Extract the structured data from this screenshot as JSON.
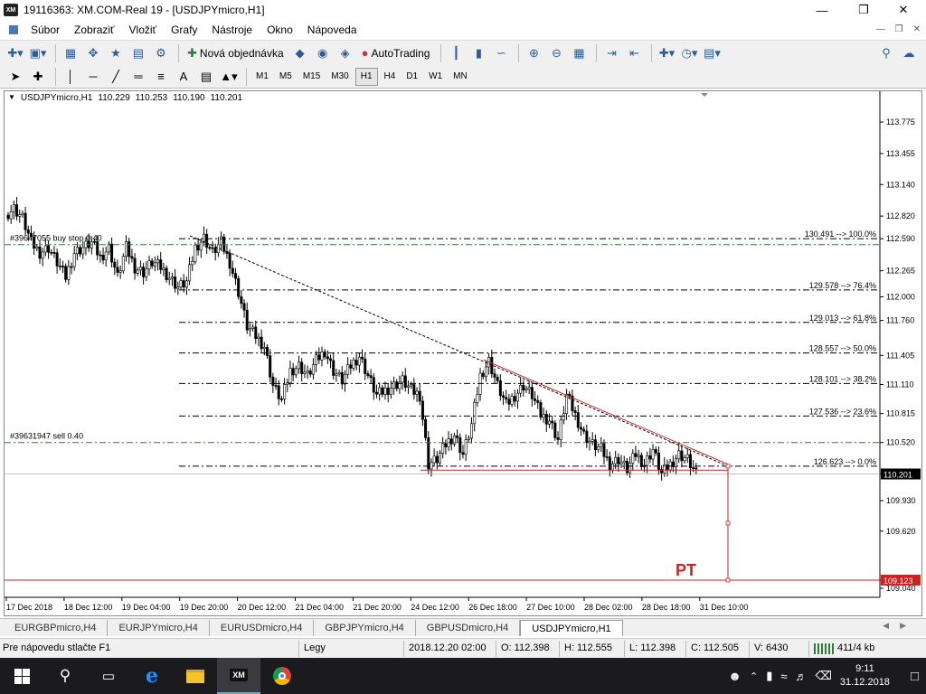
{
  "window": {
    "title": "19116363: XM.COM-Real 19 - [USDJPYmicro,H1]",
    "logo": "XM"
  },
  "menu": [
    "Súbor",
    "Zobraziť",
    "Vložiť",
    "Grafy",
    "Nástroje",
    "Okno",
    "Nápoveda"
  ],
  "toolbar": {
    "new_order": "Nová objednávka",
    "autotrading": "AutoTrading"
  },
  "timeframes": [
    "M1",
    "M5",
    "M15",
    "M30",
    "H1",
    "H4",
    "D1",
    "W1",
    "MN"
  ],
  "active_timeframe": "H1",
  "chart": {
    "symbol": "USDJPYmicro,H1",
    "ohlc": [
      "110.229",
      "110.253",
      "110.190",
      "110.201"
    ],
    "orders": [
      "#39647055 buy stop 0.40",
      "#39631947 sell 0.40"
    ],
    "target_label": "PT",
    "colors": {
      "candle": "#000000",
      "fibo": "#000000",
      "trendline": "#cc2222",
      "order": "#2e7d32",
      "target": "#cc2222"
    }
  },
  "chart_data": {
    "type": "candlestick",
    "title": "",
    "ylim": [
      109.04,
      113.95
    ],
    "y_ticks": [
      "113.775",
      "113.455",
      "113.140",
      "112.820",
      "112.590",
      "112.265",
      "112.000",
      "111.760",
      "111.405",
      "111.110",
      "110.815",
      "110.520",
      "110.201",
      "109.930",
      "109.620",
      "109.123",
      "109.040"
    ],
    "x_ticks": [
      "17 Dec 2018",
      "18 Dec 12:00",
      "19 Dec 04:00",
      "19 Dec 20:00",
      "20 Dec 12:00",
      "21 Dec 04:00",
      "21 Dec 20:00",
      "24 Dec 12:00",
      "26 Dec 18:00",
      "27 Dec 10:00",
      "28 Dec 02:00",
      "28 Dec 18:00",
      "31 Dec 10:00"
    ],
    "current_price": "110.201",
    "target_price": "109.123",
    "fibonacci": [
      {
        "label": "130.491 --> 100.0%",
        "price": 112.59
      },
      {
        "label": "129.578 --> 76.4%",
        "price": 112.07
      },
      {
        "label": "129.013 --> 61.8%",
        "price": 111.74
      },
      {
        "label": "128.557 --> 50.0%",
        "price": 111.43
      },
      {
        "label": "128.101 --> 38.2%",
        "price": 111.12
      },
      {
        "label": "127.536 --> 23.6%",
        "price": 110.79
      },
      {
        "label": "126.623 --> 0.0%",
        "price": 110.28
      }
    ],
    "order_lines": [
      112.53,
      110.52
    ],
    "path": [
      112.83,
      112.9,
      112.8,
      112.55,
      112.45,
      112.5,
      112.35,
      112.2,
      112.45,
      112.5,
      112.55,
      112.4,
      112.5,
      112.2,
      112.5,
      112.3,
      112.25,
      112.35,
      112.3,
      112.2,
      112.1,
      112.15,
      112.5,
      112.6,
      112.45,
      112.55,
      112.35,
      112.05,
      111.7,
      111.6,
      111.5,
      111.1,
      110.95,
      111.25,
      111.3,
      111.2,
      111.35,
      111.45,
      111.25,
      111.15,
      111.3,
      111.4,
      111.2,
      111.0,
      111.05,
      111.1,
      111.15,
      111.05,
      111.0,
      110.3,
      110.35,
      110.5,
      110.6,
      110.4,
      110.7,
      111.2,
      111.35,
      111.1,
      110.9,
      111.0,
      111.1,
      111.0,
      110.8,
      110.75,
      110.55,
      111.0,
      110.8,
      110.6,
      110.5,
      110.45,
      110.3,
      110.35,
      110.25,
      110.4,
      110.3,
      110.45,
      110.2,
      110.3,
      110.4,
      110.35,
      110.2
    ]
  },
  "tabs": [
    "EURGBPmicro,H4",
    "EURJPYmicro,H4",
    "EURUSDmicro,H4",
    "GBPJPYmicro,H4",
    "GBPUSDmicro,H4",
    "USDJPYmicro,H1"
  ],
  "active_tab": "USDJPYmicro,H1",
  "status": {
    "help": "Pre nápovedu stlačte F1",
    "profile": "Legy",
    "datetime": "2018.12.20 02:00",
    "open": "O: 112.398",
    "high": "H: 112.555",
    "low": "L: 112.398",
    "close": "C: 112.505",
    "volume": "V: 6430",
    "traffic": "411/4 kb"
  },
  "taskbar": {
    "time": "9:11",
    "date": "31.12.2018",
    "apps": [
      "start-icon",
      "search-icon",
      "task-view-icon",
      "edge-icon",
      "explorer-icon",
      "xm-icon",
      "chrome-icon"
    ]
  }
}
